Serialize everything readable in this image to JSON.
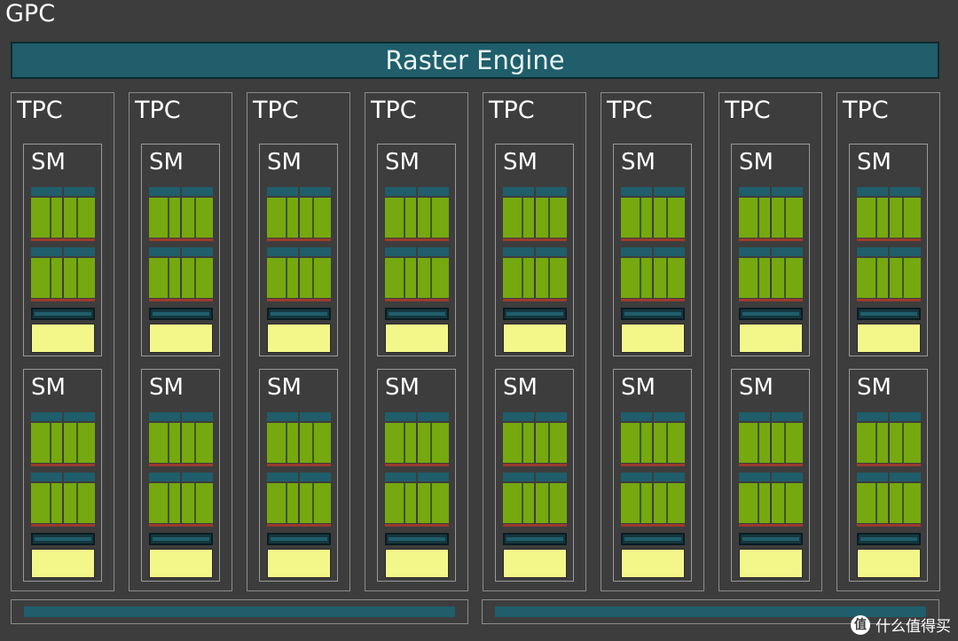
{
  "gpc_label": "GPC",
  "raster_engine_label": "Raster Engine",
  "tpc_label": "TPC",
  "sm_label": "SM",
  "tpc_count": 8,
  "sms_per_tpc": 2,
  "watermark_text": "什么值得买",
  "watermark_icon": "值",
  "colors": {
    "background": "#3d3d3d",
    "raster": "#1f5e6a",
    "core": "#76a80f",
    "l1_cache": "#f3f78a",
    "register": "#9a3b2e"
  }
}
